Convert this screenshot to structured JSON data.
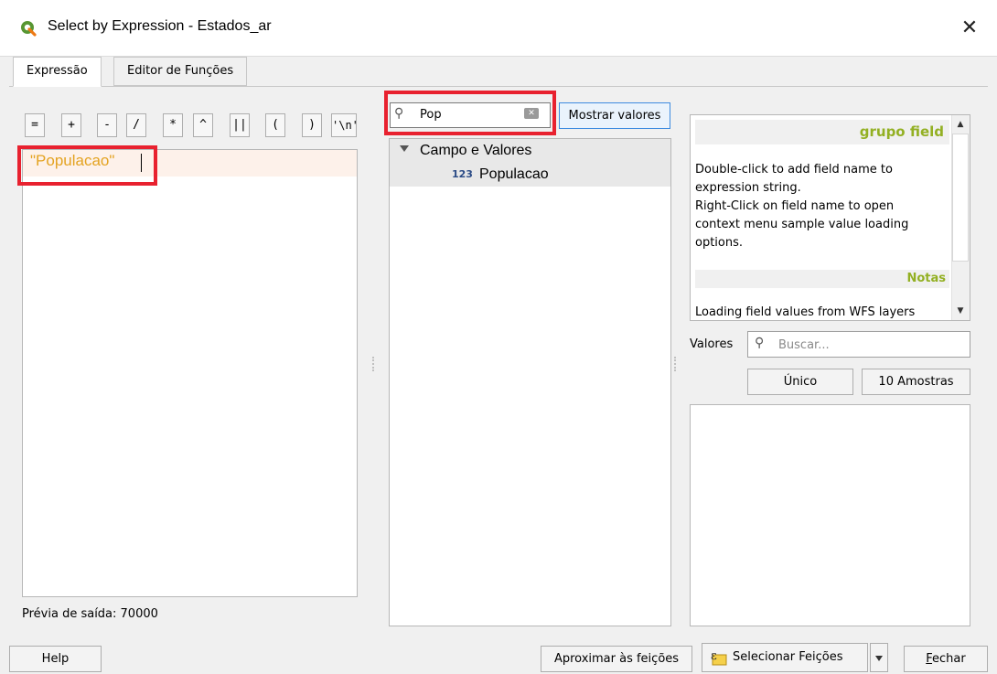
{
  "window": {
    "title": "Select by Expression - Estados_ar",
    "close_glyph": "✕"
  },
  "tabs": [
    {
      "label": "Expressão",
      "active": true
    },
    {
      "label": "Editor de Funções",
      "active": false
    }
  ],
  "operators": [
    "=",
    "+",
    "-",
    "/",
    "*",
    "^",
    "||",
    "(",
    ")",
    "'\\n'"
  ],
  "editor": {
    "expression": "\"Populacao\""
  },
  "preview": {
    "text": "Prévia de saída: 70000"
  },
  "search": {
    "value": "Pop",
    "icon": "search-icon",
    "show_values_label": "Mostrar valores"
  },
  "tree": {
    "group_label": "Campo e Valores",
    "items": [
      {
        "type_icon": "123",
        "label": "Populacao"
      }
    ]
  },
  "help": {
    "title": "grupo field",
    "lines": [
      "Double-click to add field name to",
      "expression string.",
      "Right-Click on field name to open",
      "context menu sample value loading",
      "options."
    ],
    "notes_title": "Notas",
    "notes_text": "Loading field values from WFS layers"
  },
  "values": {
    "label": "Valores",
    "placeholder": "Buscar...",
    "unique_label": "Único",
    "sample_label": "10 Amostras"
  },
  "footer": {
    "help_label": "Help",
    "zoom_label": "Aproximar às feições",
    "select_label": "Selecionar Feições",
    "close_label_first": "F",
    "close_label_rest": "echar"
  },
  "colors": {
    "highlight": "#e8212f",
    "expression_text": "#e4a321",
    "help_title": "#93b023",
    "qgis_green": "#589632"
  }
}
